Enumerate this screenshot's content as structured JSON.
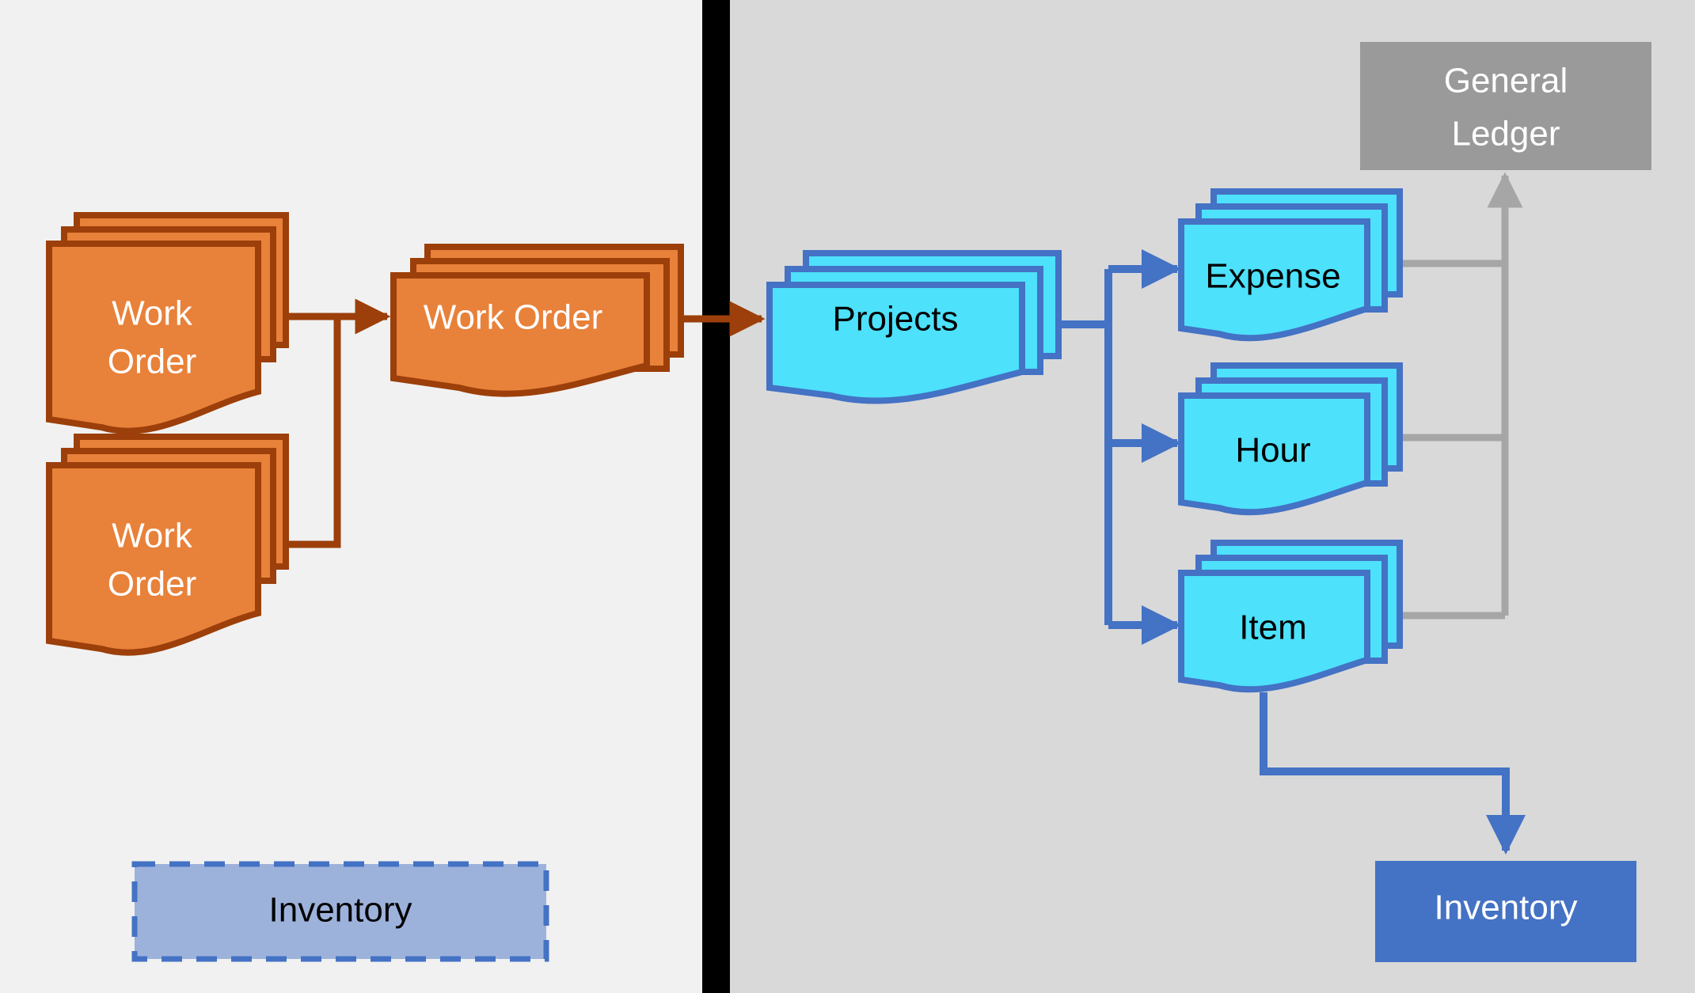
{
  "diagram": {
    "title": "Work Order to Projects transaction flow",
    "type": "flow-diagram",
    "background_left_color": "#F1F1F1",
    "background_right_color": "#D9D9D9",
    "divider_color": "#000000",
    "colors": {
      "orange_fill": "#E8813A",
      "orange_border": "#9C3F0A",
      "cyan_fill": "#4DE1FB",
      "cyan_border": "#4472C4",
      "gray_fill": "#9A9A9A",
      "gray_connector": "#A6A6A6",
      "blue_solid_fill": "#4472C4",
      "blue_soft_fill": "#9DB2DB",
      "blue_dashed_border": "#4472C4",
      "white_text": "#FFFFFF",
      "black_text": "#000000"
    },
    "panes": {
      "left": {
        "name": "left-pane"
      },
      "right": {
        "name": "right-pane"
      }
    },
    "nodes": [
      {
        "id": "work-order-top",
        "label_lines": [
          "Work",
          "Order"
        ],
        "shape": "document-stack",
        "fill": "#E8813A",
        "border": "#9C3F0A",
        "text_color": "#FFFFFF",
        "pane": "left"
      },
      {
        "id": "work-order-bottom",
        "label_lines": [
          "Work",
          "Order"
        ],
        "shape": "document-stack",
        "fill": "#E8813A",
        "border": "#9C3F0A",
        "text_color": "#FFFFFF",
        "pane": "left"
      },
      {
        "id": "work-order-merged",
        "label_lines": [
          "Work Order"
        ],
        "shape": "document-stack",
        "fill": "#E8813A",
        "border": "#9C3F0A",
        "text_color": "#FFFFFF",
        "pane": "left"
      },
      {
        "id": "projects",
        "label_lines": [
          "Projects"
        ],
        "shape": "document-stack",
        "fill": "#4DE1FB",
        "border": "#4472C4",
        "text_color": "#000000",
        "pane": "right"
      },
      {
        "id": "expense",
        "label_lines": [
          "Expense"
        ],
        "shape": "document-stack",
        "fill": "#4DE1FB",
        "border": "#4472C4",
        "text_color": "#000000",
        "pane": "right"
      },
      {
        "id": "hour",
        "label_lines": [
          "Hour"
        ],
        "shape": "document-stack",
        "fill": "#4DE1FB",
        "border": "#4472C4",
        "text_color": "#000000",
        "pane": "right"
      },
      {
        "id": "item",
        "label_lines": [
          "Item"
        ],
        "shape": "document-stack",
        "fill": "#4DE1FB",
        "border": "#4472C4",
        "text_color": "#000000",
        "pane": "right"
      },
      {
        "id": "general-ledger",
        "label_lines": [
          "General",
          "Ledger"
        ],
        "shape": "rectangle",
        "fill": "#9A9A9A",
        "border": "none",
        "text_color": "#FFFFFF",
        "pane": "right"
      },
      {
        "id": "inventory-left",
        "label_lines": [
          "Inventory"
        ],
        "shape": "rectangle-dashed",
        "fill": "#9DB2DB",
        "border": "#4472C4",
        "text_color": "#000000",
        "pane": "left"
      },
      {
        "id": "inventory-right",
        "label_lines": [
          "Inventory"
        ],
        "shape": "rectangle",
        "fill": "#4472C4",
        "border": "none",
        "text_color": "#FFFFFF",
        "pane": "right"
      }
    ],
    "edges": [
      {
        "id": "wo-top-to-merged",
        "from": "work-order-top",
        "to": "work-order-merged",
        "color": "#9C3F0A",
        "arrow": true
      },
      {
        "id": "wo-bottom-to-merged",
        "from": "work-order-bottom",
        "to": "work-order-merged",
        "color": "#9C3F0A",
        "arrow": false
      },
      {
        "id": "merged-to-projects",
        "from": "work-order-merged",
        "to": "projects",
        "color": "#9C3F0A",
        "arrow": true
      },
      {
        "id": "projects-to-expense",
        "from": "projects",
        "to": "expense",
        "color": "#4472C4",
        "arrow": true
      },
      {
        "id": "projects-to-hour",
        "from": "projects",
        "to": "hour",
        "color": "#4472C4",
        "arrow": true
      },
      {
        "id": "projects-to-item",
        "from": "projects",
        "to": "item",
        "color": "#4472C4",
        "arrow": true
      },
      {
        "id": "expense-to-gl",
        "from": "expense",
        "to": "general-ledger",
        "color": "#A6A6A6",
        "arrow": false
      },
      {
        "id": "hour-to-gl",
        "from": "hour",
        "to": "general-ledger",
        "color": "#A6A6A6",
        "arrow": false
      },
      {
        "id": "item-to-gl",
        "from": "item",
        "to": "general-ledger",
        "color": "#A6A6A6",
        "arrow": true
      },
      {
        "id": "item-to-inventory",
        "from": "item",
        "to": "inventory-right",
        "color": "#4472C4",
        "arrow": true
      }
    ],
    "labels": {
      "work_order": "Work Order",
      "work_line1": "Work",
      "work_line2": "Order",
      "projects": "Projects",
      "expense": "Expense",
      "hour": "Hour",
      "item": "Item",
      "general_line1": "General",
      "general_line2": "Ledger",
      "inventory": "Inventory"
    }
  }
}
